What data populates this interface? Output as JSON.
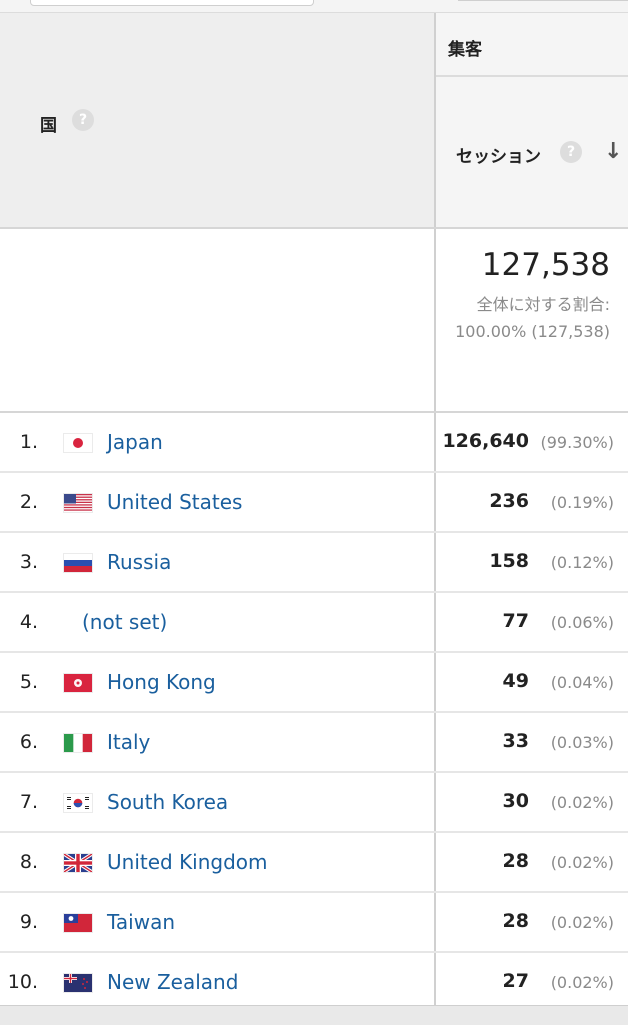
{
  "header": {
    "dimension_label": "国",
    "help_glyph": "?",
    "group_label": "集客",
    "metric_label": "セッション",
    "sort_glyph": "↓"
  },
  "totals": {
    "value": "127,538",
    "share_label": "全体に対する割合:",
    "share_value": "100.00% (127,538)"
  },
  "rows": [
    {
      "rank": "1.",
      "country": "Japan",
      "flag": "jp",
      "sessions": "126,640",
      "pct": "(99.30%)"
    },
    {
      "rank": "2.",
      "country": "United States",
      "flag": "us",
      "sessions": "236",
      "pct": "(0.19%)"
    },
    {
      "rank": "3.",
      "country": "Russia",
      "flag": "ru",
      "sessions": "158",
      "pct": "(0.12%)"
    },
    {
      "rank": "4.",
      "country": "(not set)",
      "flag": "",
      "sessions": "77",
      "pct": "(0.06%)"
    },
    {
      "rank": "5.",
      "country": "Hong Kong",
      "flag": "hk",
      "sessions": "49",
      "pct": "(0.04%)"
    },
    {
      "rank": "6.",
      "country": "Italy",
      "flag": "it",
      "sessions": "33",
      "pct": "(0.03%)"
    },
    {
      "rank": "7.",
      "country": "South Korea",
      "flag": "kr",
      "sessions": "30",
      "pct": "(0.02%)"
    },
    {
      "rank": "8.",
      "country": "United Kingdom",
      "flag": "gb",
      "sessions": "28",
      "pct": "(0.02%)"
    },
    {
      "rank": "9.",
      "country": "Taiwan",
      "flag": "tw",
      "sessions": "28",
      "pct": "(0.02%)"
    },
    {
      "rank": "10.",
      "country": "New Zealand",
      "flag": "nz",
      "sessions": "27",
      "pct": "(0.02%)"
    }
  ],
  "colors": {
    "link": "#1a5f9e",
    "header_bg": "#eeeeee",
    "muted": "#8a8a8a"
  }
}
